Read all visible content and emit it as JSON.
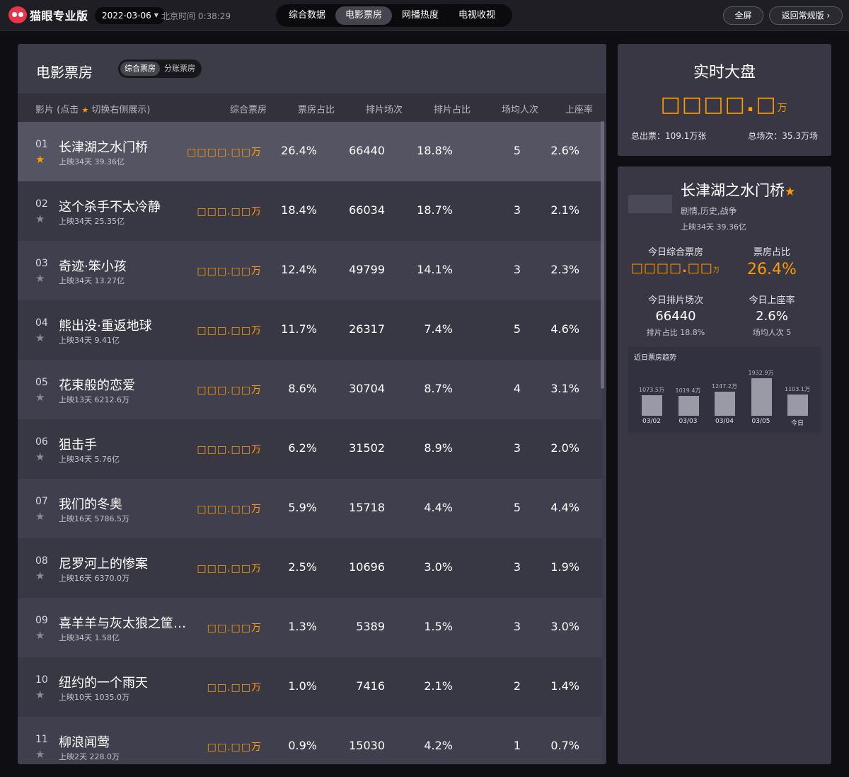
{
  "app": {
    "name": "猫眼专业版"
  },
  "topbar": {
    "date": "2022-03-06",
    "clock": "北京时间 0:38:29",
    "tabs": [
      "综合数据",
      "电影票房",
      "网播热度",
      "电视收视"
    ],
    "active_tab": "电影票房",
    "fullscreen": "全屏",
    "back": "返回常规版"
  },
  "main": {
    "title": "电影票房",
    "segments": [
      "综合票房",
      "分账票房"
    ],
    "headers": {
      "film": "影片 (点击",
      "film_tail": "切换右侧展示)",
      "box": "综合票房",
      "box_share": "票房占比",
      "shows": "排片场次",
      "show_share": "排片占比",
      "avg": "场均人次",
      "seat": "上座率"
    },
    "rows": [
      {
        "rank": "01",
        "name": "长津湖之水门桥",
        "sub": "上映34天  39.36亿",
        "box": "□□□□.□□万",
        "box_share": "26.4%",
        "shows": "66440",
        "show_share": "18.8%",
        "avg": "5",
        "seat": "2.6%",
        "starred": true
      },
      {
        "rank": "02",
        "name": "这个杀手不太冷静",
        "sub": "上映34天  25.35亿",
        "box": "□□□.□□万",
        "box_share": "18.4%",
        "shows": "66034",
        "show_share": "18.7%",
        "avg": "3",
        "seat": "2.1%",
        "starred": false
      },
      {
        "rank": "03",
        "name": "奇迹·笨小孩",
        "sub": "上映34天  13.27亿",
        "box": "□□□.□□万",
        "box_share": "12.4%",
        "shows": "49799",
        "show_share": "14.1%",
        "avg": "3",
        "seat": "2.3%",
        "starred": false
      },
      {
        "rank": "04",
        "name": "熊出没·重返地球",
        "sub": "上映34天  9.41亿",
        "box": "□□□.□□万",
        "box_share": "11.7%",
        "shows": "26317",
        "show_share": "7.4%",
        "avg": "5",
        "seat": "4.6%",
        "starred": false
      },
      {
        "rank": "05",
        "name": "花束般的恋爱",
        "sub": "上映13天  6212.6万",
        "box": "□□□.□□万",
        "box_share": "8.6%",
        "shows": "30704",
        "show_share": "8.7%",
        "avg": "4",
        "seat": "3.1%",
        "starred": false
      },
      {
        "rank": "06",
        "name": "狙击手",
        "sub": "上映34天  5.76亿",
        "box": "□□□.□□万",
        "box_share": "6.2%",
        "shows": "31502",
        "show_share": "8.9%",
        "avg": "3",
        "seat": "2.0%",
        "starred": false
      },
      {
        "rank": "07",
        "name": "我们的冬奥",
        "sub": "上映16天  5786.5万",
        "box": "□□□.□□万",
        "box_share": "5.9%",
        "shows": "15718",
        "show_share": "4.4%",
        "avg": "5",
        "seat": "4.4%",
        "starred": false
      },
      {
        "rank": "08",
        "name": "尼罗河上的惨案",
        "sub": "上映16天  6370.0万",
        "box": "□□□.□□万",
        "box_share": "2.5%",
        "shows": "10696",
        "show_share": "3.0%",
        "avg": "3",
        "seat": "1.9%",
        "starred": false
      },
      {
        "rank": "09",
        "name": "喜羊羊与灰太狼之筐…",
        "sub": "上映34天  1.58亿",
        "box": "□□.□□万",
        "box_share": "1.3%",
        "shows": "5389",
        "show_share": "1.5%",
        "avg": "3",
        "seat": "3.0%",
        "starred": false
      },
      {
        "rank": "10",
        "name": "纽约的一个雨天",
        "sub": "上映10天  1035.0万",
        "box": "□□.□□万",
        "box_share": "1.0%",
        "shows": "7416",
        "show_share": "2.1%",
        "avg": "2",
        "seat": "1.4%",
        "starred": false
      },
      {
        "rank": "11",
        "name": "柳浪闻莺",
        "sub": "上映2天  228.0万",
        "box": "□□.□□万",
        "box_share": "0.9%",
        "shows": "15030",
        "show_share": "4.2%",
        "avg": "1",
        "seat": "0.7%",
        "starred": false
      }
    ]
  },
  "realtime": {
    "title": "实时大盘",
    "value": "□□□□.□",
    "unit": "万",
    "tickets": "总出票：109.1万张",
    "shows": "总场次：35.3万场"
  },
  "detail": {
    "name": "长津湖之水门桥",
    "genre": "剧情,历史,战争",
    "release": "上映34天  39.36亿",
    "stats": {
      "box_label": "今日综合票房",
      "box_value": "□□□□.□□",
      "box_unit": "万",
      "share_label": "票房占比",
      "share_value": "26.4%",
      "shows_label": "今日排片场次",
      "shows_value": "66440",
      "shows_sub": "排片占比 18.8%",
      "seat_label": "今日上座率",
      "seat_value": "2.6%",
      "seat_sub": "场均人次 5"
    },
    "trend": {
      "title": "近日票房趋势",
      "chart_data": {
        "type": "bar",
        "categories": [
          "03/02",
          "03/03",
          "03/04",
          "03/05",
          "今日"
        ],
        "values": [
          1073.5,
          1019.4,
          1247.2,
          1932.9,
          1103.1
        ],
        "labels": [
          "1073.5万",
          "1019.4万",
          "1247.2万",
          "1932.9万",
          "1103.1万"
        ]
      }
    }
  },
  "colors": {
    "accent": "#ff9a00",
    "panel": "#383743",
    "background": "#0f0f13"
  }
}
